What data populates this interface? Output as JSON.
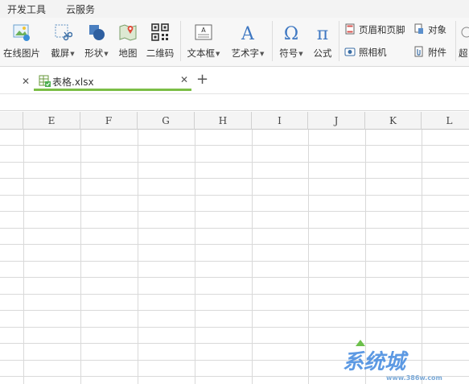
{
  "menu": {
    "items": [
      "开发工具",
      "云服务"
    ]
  },
  "ribbon": {
    "online_image": "在线图片",
    "screenshot": "截屏",
    "shape": "形状",
    "map": "地图",
    "qrcode": "二维码",
    "textbox": "文本框",
    "wordart": "艺术字",
    "symbol": "符号",
    "formula": "公式",
    "header_footer": "页眉和页脚",
    "object": "对象",
    "camera": "照相机",
    "attachment": "附件",
    "overflow": "超"
  },
  "tabs": {
    "document": "表格.xlsx"
  },
  "sheet": {
    "columns": [
      "E",
      "F",
      "G",
      "H",
      "I",
      "J",
      "K",
      "L"
    ]
  },
  "watermark": {
    "text": "系统城",
    "url": "www.386w.com"
  },
  "colors": {
    "accent": "#7cbe46",
    "grid_line": "#d9d9d9",
    "header_bg": "#f4f4f4"
  }
}
